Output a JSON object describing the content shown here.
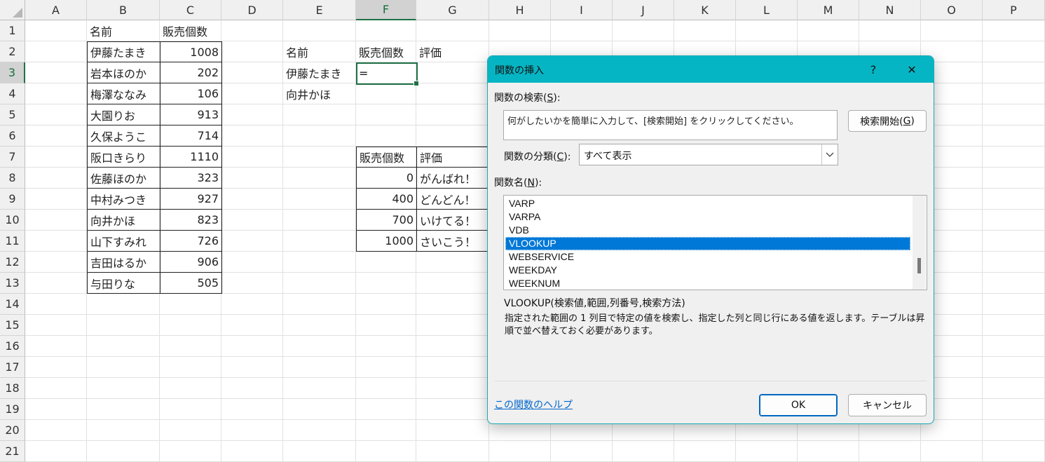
{
  "sheet": {
    "columns": [
      "A",
      "B",
      "C",
      "D",
      "E",
      "F",
      "G",
      "H",
      "I",
      "J",
      "K",
      "L",
      "M",
      "N",
      "O",
      "P"
    ],
    "selected_column": "F",
    "rows": [
      "1",
      "2",
      "3",
      "4",
      "5",
      "6",
      "7",
      "8",
      "9",
      "10",
      "11",
      "12",
      "13",
      "14",
      "15",
      "16",
      "17",
      "18",
      "19",
      "20",
      "21"
    ],
    "selected_row": "3",
    "table1": {
      "headers": [
        "名前",
        "販売個数"
      ],
      "rows": [
        {
          "name": "伊藤たまき",
          "count": "1008"
        },
        {
          "name": "岩本ほのか",
          "count": "202"
        },
        {
          "name": "梅澤ななみ",
          "count": "106"
        },
        {
          "name": "大園りお",
          "count": "913"
        },
        {
          "name": "久保ようこ",
          "count": "714"
        },
        {
          "name": "阪口きらり",
          "count": "1110"
        },
        {
          "name": "佐藤ほのか",
          "count": "323"
        },
        {
          "name": "中村みつき",
          "count": "927"
        },
        {
          "name": "向井かほ",
          "count": "823"
        },
        {
          "name": "山下すみれ",
          "count": "726"
        },
        {
          "name": "吉田はるか",
          "count": "906"
        },
        {
          "name": "与田りな",
          "count": "505"
        }
      ]
    },
    "lookup": {
      "headers": [
        "名前",
        "販売個数",
        "評価"
      ],
      "names": [
        "伊藤たまき",
        "向井かほ"
      ],
      "active_value": "="
    },
    "table2": {
      "headers": [
        "販売個数",
        "評価"
      ],
      "rows": [
        {
          "count": "0",
          "rating": "がんばれ！"
        },
        {
          "count": "400",
          "rating": "どんどん！"
        },
        {
          "count": "700",
          "rating": "いけてる！"
        },
        {
          "count": "1000",
          "rating": "さいこう！"
        }
      ]
    }
  },
  "dialog": {
    "title": "関数の挿入",
    "help_glyph": "?",
    "close_glyph": "✕",
    "search_label": "関数の検索(",
    "search_key": "S",
    "search_label_end": "):",
    "search_placeholder": "何がしたいかを簡単に入力して、[検索開始] をクリックしてください。",
    "search_button": "検索開始(",
    "search_button_key": "G",
    "search_button_end": ")",
    "category_label": "関数の分類(",
    "category_key": "C",
    "category_label_end": "):",
    "category_value": "すべて表示",
    "name_label": "関数名(",
    "name_key": "N",
    "name_label_end": "):",
    "functions": [
      "VARP",
      "VARPA",
      "VDB",
      "VLOOKUP",
      "WEBSERVICE",
      "WEEKDAY",
      "WEEKNUM"
    ],
    "selected_function": "VLOOKUP",
    "syntax": "VLOOKUP(検索値,範囲,列番号,検索方法)",
    "description": "指定された範囲の 1 列目で特定の値を検索し、指定した列と同じ行にある値を返します。テーブルは昇順で並べ替えておく必要があります。",
    "help_link": "この関数のヘルプ",
    "ok": "OK",
    "cancel": "キャンセル"
  }
}
